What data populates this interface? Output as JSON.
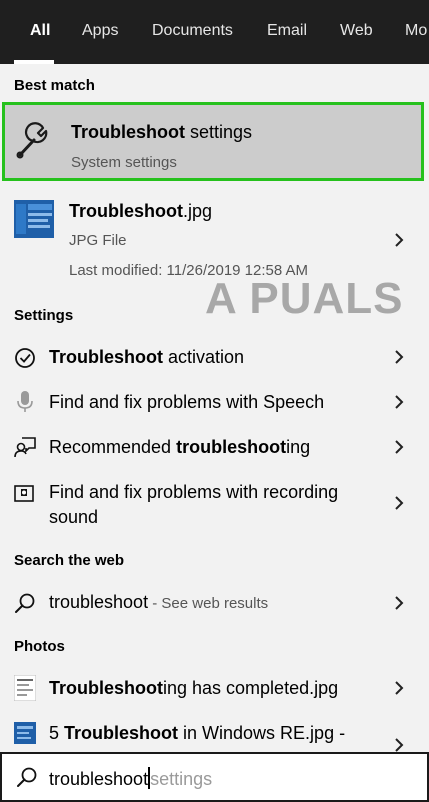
{
  "tabs": [
    {
      "label": "All",
      "active": true
    },
    {
      "label": "Apps"
    },
    {
      "label": "Documents"
    },
    {
      "label": "Email"
    },
    {
      "label": "Web"
    },
    {
      "label": "Mo"
    }
  ],
  "best_match": {
    "header": "Best match",
    "title_bold": "Troubleshoot",
    "title_rest": " settings",
    "subtitle": "System settings",
    "icon": "wrench-icon",
    "highlight_color": "#26c11d"
  },
  "file_result": {
    "title_bold": "Troubleshoot",
    "title_rest": ".jpg",
    "type": "JPG File",
    "modified": "Last modified: 11/26/2019 12:58 AM",
    "icon": "image-file-icon"
  },
  "watermark": "A PUALS",
  "settings": {
    "header": "Settings",
    "items": [
      {
        "bold": "Troubleshoot",
        "rest": " activation",
        "icon": "check-circle-icon"
      },
      {
        "pre": "Find and fix problems with Speech",
        "icon": "microphone-icon"
      },
      {
        "pre": "Recommended ",
        "bold": "troubleshoot",
        "rest": "ing",
        "icon": "person-chat-icon"
      },
      {
        "line1": "Find and fix problems with recording",
        "line2": "sound",
        "icon": "recorder-icon"
      }
    ]
  },
  "web": {
    "header": "Search the web",
    "query": "troubleshoot",
    "hint": " - See web results",
    "icon": "search-icon"
  },
  "photos": {
    "header": "Photos",
    "items": [
      {
        "bold": "Troubleshoot",
        "rest": "ing has completed.jpg",
        "icon": "document-image-icon"
      },
      {
        "pre": "5 ",
        "bold": "Troubleshoot",
        "rest": " in Windows RE.jpg -",
        "icon": "blue-image-icon"
      }
    ]
  },
  "search": {
    "value": "troubleshoot",
    "hint": "settings",
    "icon": "search-icon"
  }
}
